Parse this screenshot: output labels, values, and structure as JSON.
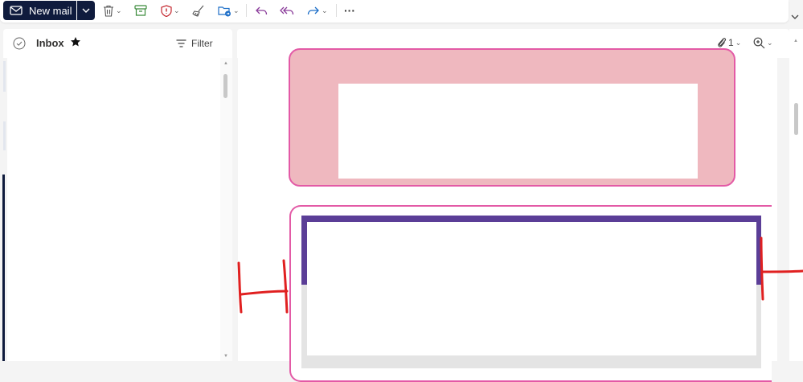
{
  "toolbar": {
    "new_mail_label": "New mail",
    "icons": [
      "mail-icon",
      "chevron-down-icon",
      "delete-icon",
      "archive-icon",
      "report-icon",
      "sweep-icon",
      "move-to-icon",
      "reply-icon",
      "reply-all-icon",
      "forward-icon",
      "more-icon"
    ],
    "more_label": "···"
  },
  "message_list": {
    "folder_title": "Inbox",
    "filter_label": "Filter"
  },
  "reading_pane": {
    "attachment_count": "1"
  },
  "colors": {
    "brand_dark": "#0f1b3d",
    "card_pink": "#efb8bf",
    "card_border": "#e35aa6",
    "header_purple": "#5b3e97",
    "annotation_red": "#e02020"
  }
}
